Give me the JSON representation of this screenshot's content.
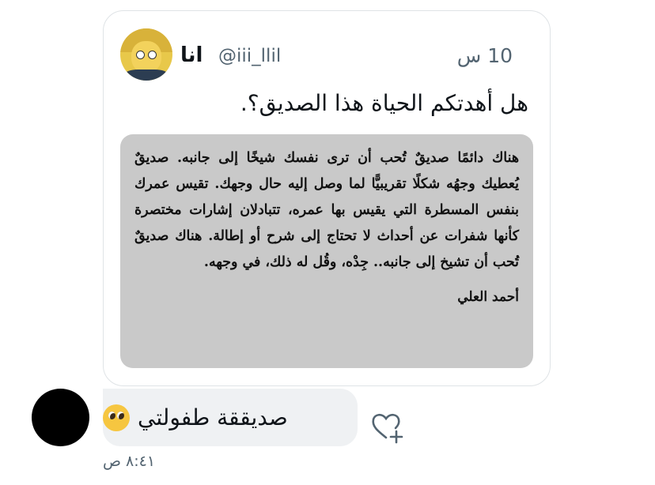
{
  "tweet": {
    "display_name": "انا",
    "handle": "@iii_llil",
    "time": "10 س",
    "text": "هل أهدتكم الحياة هذا الصديق؟.",
    "image": {
      "body": "هناك دائمًا صديقٌ تُحب أن ترى نفسك شيخًا إلى جانبه. صديقٌ يُعطيك وجهُه شكلًا تقريبيًّا لما وصل إليه حال وجهك. تقيس عمرك بنفس المسطرة التي يقيس بها عمره، تتبادلان إشارات مختصرة كأنها شفرات عن أحداث لا تحتاج إلى شرح أو إطالة. هناك صديقٌ تُحب أن تشيخ إلى جانبه.. جِدْه، وقُل له ذلك، في وجهه.",
      "author": "أحمد العلي"
    }
  },
  "reply": {
    "text": "صديققة طفولتي",
    "emoji": "pleading-face-emoji",
    "timestamp": "٨:٤١ ص"
  },
  "icons": {
    "react": "heart-plus-icon"
  }
}
